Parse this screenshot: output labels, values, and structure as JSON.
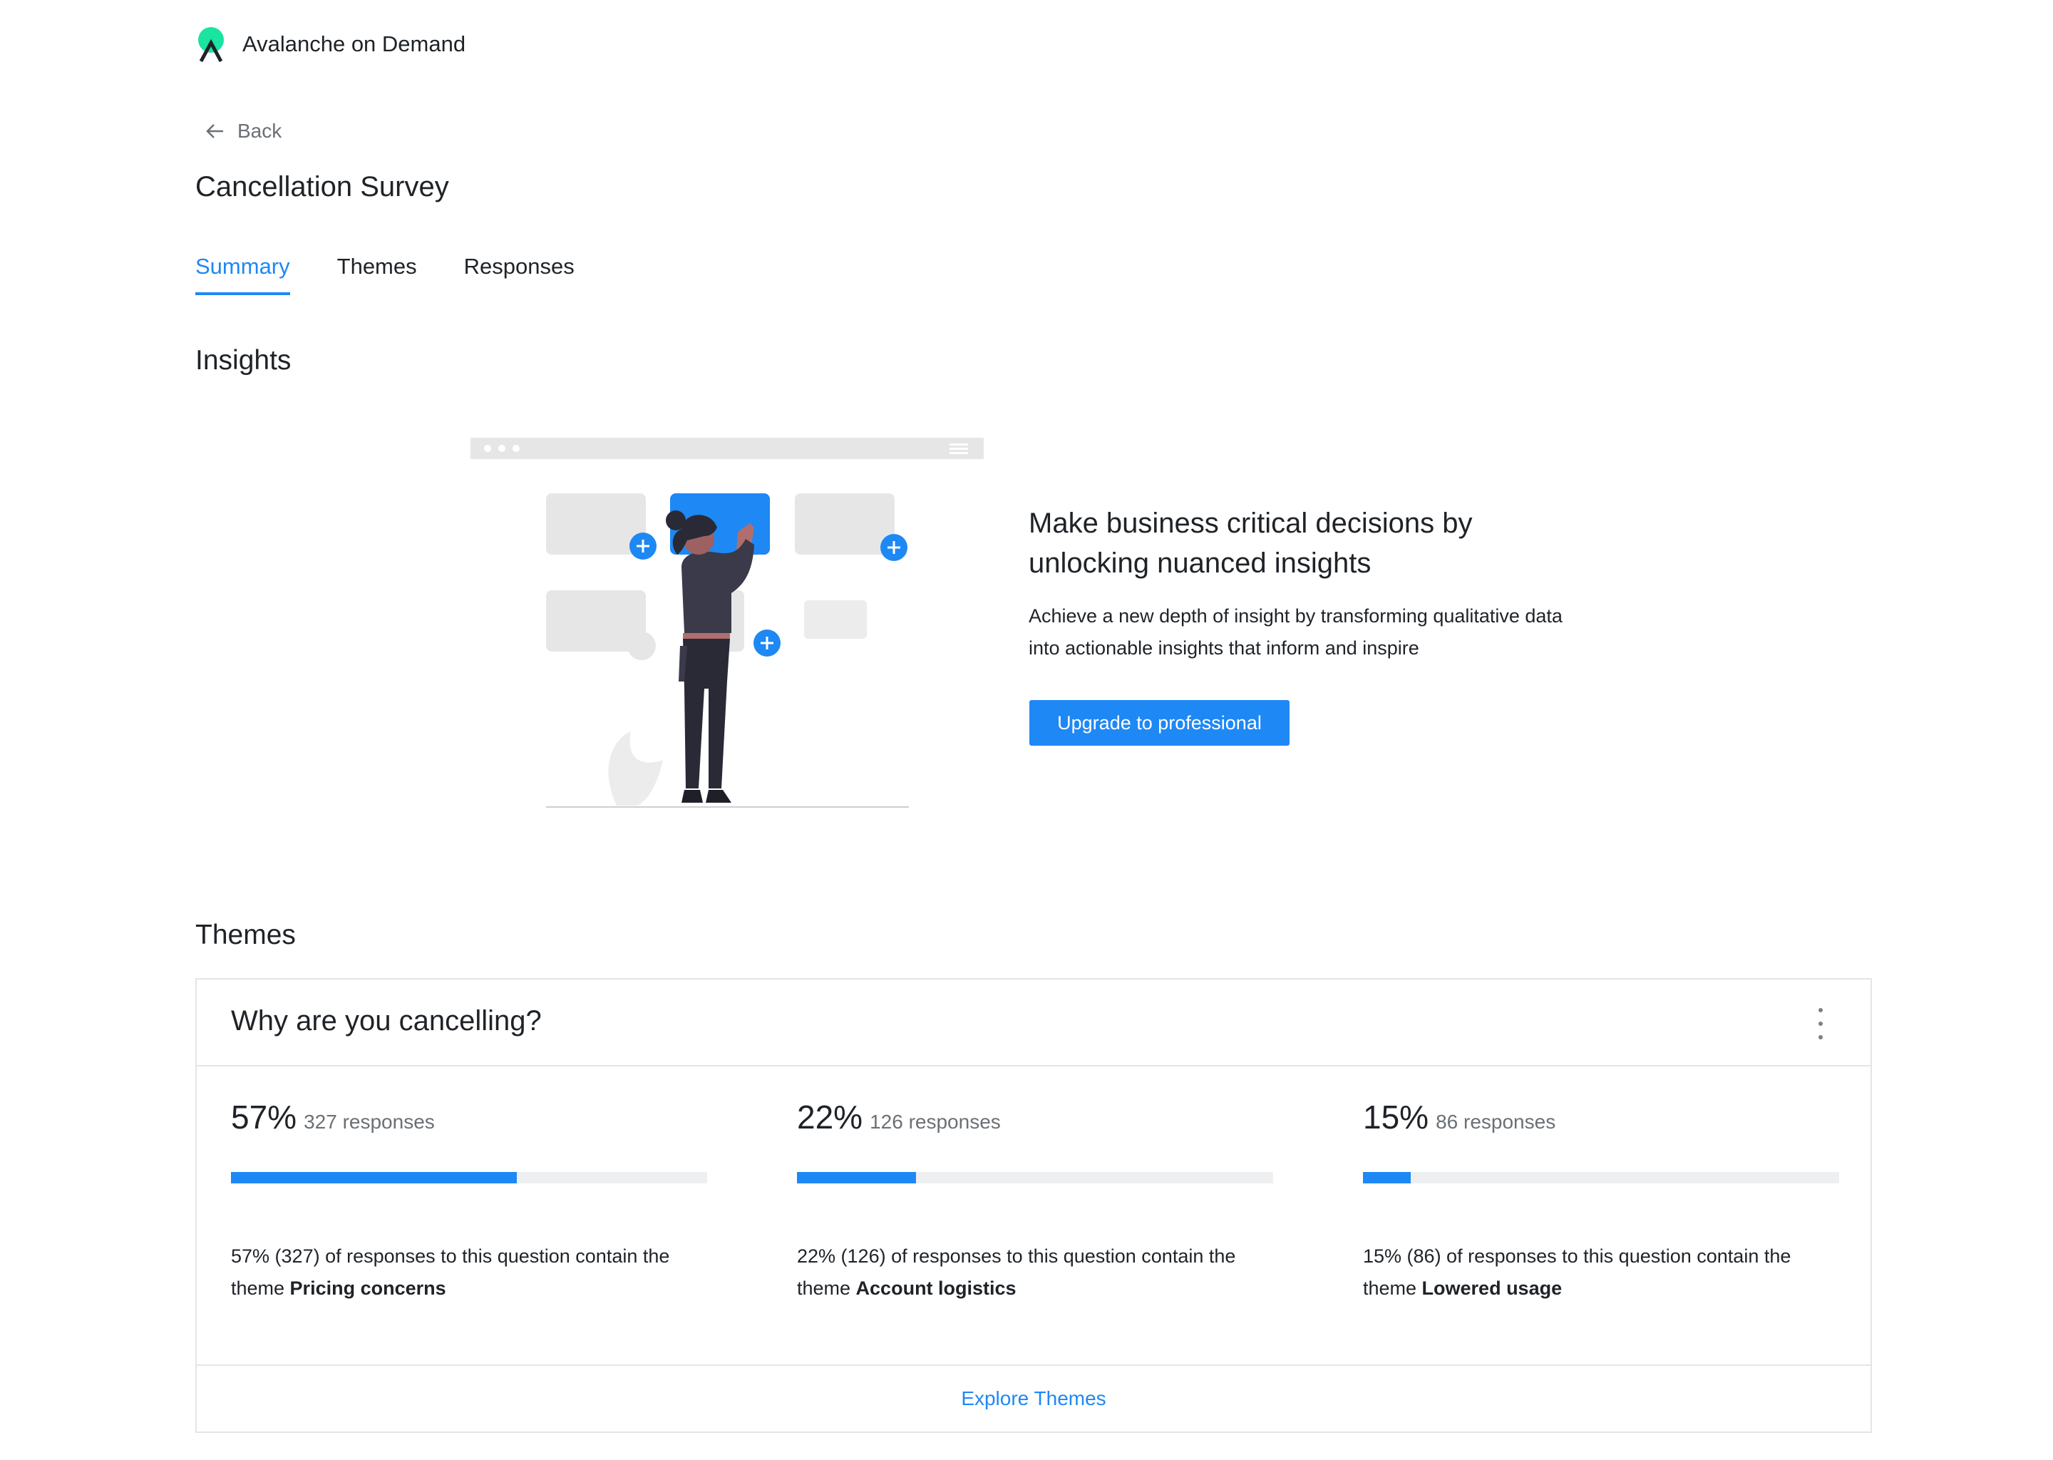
{
  "brand": {
    "name": "Avalanche on Demand"
  },
  "nav": {
    "back_label": "Back"
  },
  "page": {
    "title": "Cancellation Survey"
  },
  "tabs": [
    {
      "label": "Summary",
      "active": true
    },
    {
      "label": "Themes",
      "active": false
    },
    {
      "label": "Responses",
      "active": false
    }
  ],
  "insights": {
    "title": "Insights",
    "heading_line1": "Make business critical decisions by",
    "heading_line2": "unlocking nuanced insights",
    "body_line1": "Achieve a new depth of insight by transforming qualitative data",
    "body_line2": "into actionable insights that inform and inspire",
    "cta_label": "Upgrade to professional"
  },
  "themes": {
    "title": "Themes",
    "question": "Why are you cancelling?",
    "stats": [
      {
        "percent": "57%",
        "count": "327 responses",
        "fill": 0.6,
        "desc_line1": "57% (327) of responses to this question contain the",
        "desc_prefix": "theme ",
        "theme": "Pricing concerns"
      },
      {
        "percent": "22%",
        "count": "126 responses",
        "fill": 0.25,
        "desc_line1": "22% (126) of responses to this question contain the",
        "desc_prefix": "theme ",
        "theme": "Account logistics"
      },
      {
        "percent": "15%",
        "count": "86 responses",
        "fill": 0.1,
        "desc_line1": "15% (86) of responses to this question contain the",
        "desc_prefix": "theme ",
        "theme": "Lowered usage"
      }
    ],
    "explore_label": "Explore Themes"
  },
  "colors": {
    "accent": "#1e88f5",
    "brand_green": "#19e4a0",
    "text": "#1f2328",
    "muted": "#6b7075",
    "border": "#e3e5e8",
    "track": "#eeeff1"
  },
  "icons": {
    "logo": "avalanche-logo-icon",
    "back": "arrow-left-icon",
    "menu": "more-vertical-icon"
  }
}
